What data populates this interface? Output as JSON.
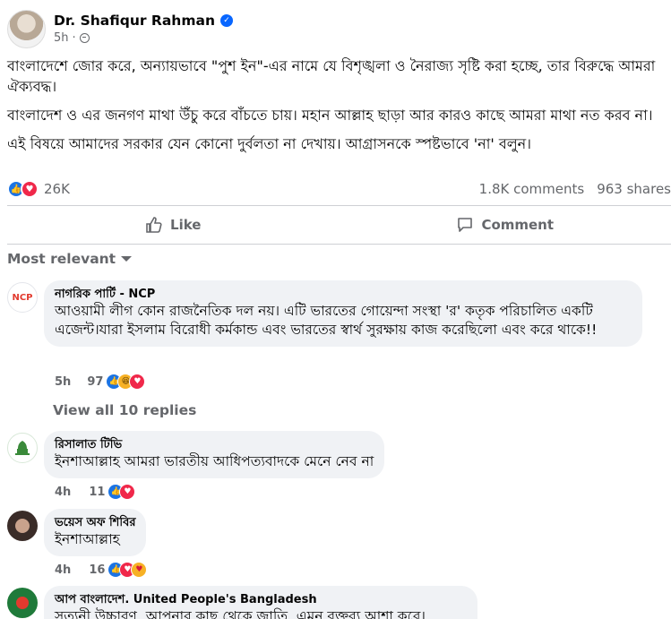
{
  "post": {
    "author": "Dr. Shafiqur Rahman",
    "time": "5h",
    "separator": "·",
    "paragraphs": [
      "বাংলাদেশে জোর করে, অন্যায়ভাবে \"পুশ ইন\"-এর নামে যে বিশৃঙ্খলা ও নৈরাজ্য সৃষ্টি করা হচ্ছে, তার বিরুদ্ধে আমরা ঐক্যবদ্ধ।",
      "বাংলাদেশ ও এর জনগণ মাথা উঁচু করে বাঁচতে চায়। মহান আল্লাহ ছাড়া আর কারও কাছে আমরা মাথা নত করব না।",
      "এই বিষয়ে আমাদের সরকার যেন কোনো দুর্বলতা না দেখায়। আগ্রাসনকে স্পষ্টভাবে 'না' বলুন।"
    ],
    "reaction_count": "26K",
    "comments_count": "1.8K comments",
    "shares_count": "963 shares",
    "reactions": [
      "like-icon",
      "love-icon"
    ]
  },
  "actions": {
    "like_label": "Like",
    "comment_label": "Comment"
  },
  "sort": {
    "label": "Most relevant"
  },
  "view_replies": "View all 10 replies",
  "comments": [
    {
      "name": "নাগরিক পার্টি - NCP",
      "avatar_text": "NCP",
      "text": "আওয়ামী লীগ কোন রাজনৈতিক দল নয়। এটি ভারতের গোয়েন্দা সংস্থা 'র' কতৃক পরিচালিত একটি এজেন্ট।যারা ইসলাম বিরোধী কর্মকান্ড এবং ভারতের স্বার্থ সুরক্ষায় কাজ করেছিলো এবং করে থাকে!!",
      "time": "5h",
      "count": "97",
      "reactions": [
        "like-icon",
        "haha-icon",
        "love-icon"
      ]
    },
    {
      "name": "রিসালাত টিভি",
      "text": "ইনশাআল্লাহ আমরা ভারতীয় আধিপত্যবাদকে মেনে নেব না",
      "time": "4h",
      "count": "11",
      "reactions": [
        "like-icon",
        "love-icon"
      ]
    },
    {
      "name": "ভয়েস অফ শিবির",
      "text": "ইনশাআল্লাহ",
      "time": "4h",
      "count": "16",
      "reactions": [
        "like-icon",
        "love-icon",
        "care-icon"
      ]
    },
    {
      "name": "আপ বাংলাদেশ. United People's Bangladesh",
      "text": "সত্যনী উচ্চারণ, আপনার কাছ থেকে জাতি, এমন বক্তব্য আশা করে।"
    }
  ],
  "colors": {
    "accent": "#0866ff",
    "secondary_text": "#65676b",
    "bubble_bg": "#f0f2f5"
  }
}
